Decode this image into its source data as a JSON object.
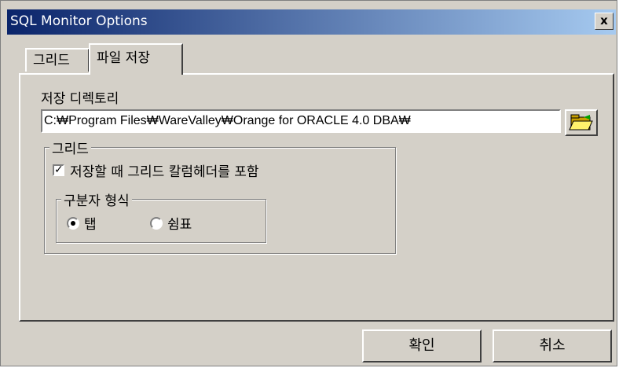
{
  "window": {
    "title": "SQL Monitor Options",
    "close_label": "x"
  },
  "tabs": [
    {
      "label": "그리드"
    },
    {
      "label": "파일 저장"
    }
  ],
  "save_dir": {
    "label": "저장 디렉토리",
    "path_value": "C:₩Program Files₩WareValley₩Orange for ORACLE 4.0 DBA₩",
    "browse_icon": "folder-open-icon"
  },
  "grid_group": {
    "legend": "그리드",
    "include_header_checkbox": {
      "label": "저장할 때 그리드 칼럼헤더를 포함",
      "checked": true
    },
    "separator_group": {
      "legend": "구분자 형식",
      "options": [
        {
          "label": "탭",
          "selected": true
        },
        {
          "label": "쉼표",
          "selected": false
        }
      ]
    }
  },
  "buttons": {
    "ok": "확인",
    "cancel": "취소"
  },
  "colors": {
    "titlebar_start": "#0a246a",
    "titlebar_end": "#a6caf0",
    "face": "#d4d0c8"
  }
}
